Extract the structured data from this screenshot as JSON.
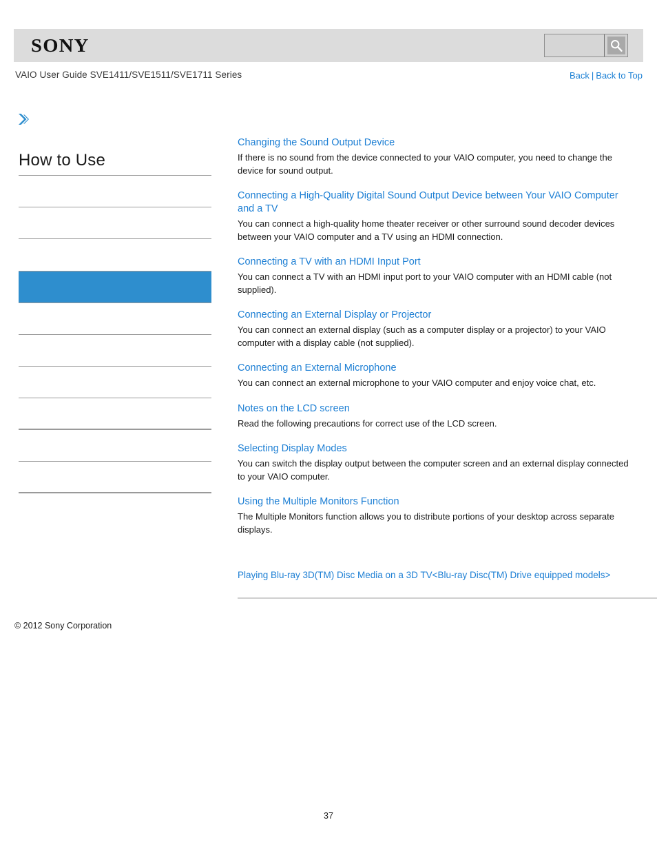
{
  "header": {
    "brand": "SONY",
    "search": {
      "value": "",
      "placeholder": ""
    },
    "search_icon": "search-icon"
  },
  "guide": {
    "title": "VAIO User Guide SVE1411/SVE1511/SVE1711 Series",
    "nav": {
      "back": "Back",
      "separator": "|",
      "back_to_top": "Back to Top"
    }
  },
  "sidebar": {
    "chevron_icon": "chevron-right-icon",
    "heading": "How to Use",
    "items": [
      {
        "label": "",
        "active": false
      },
      {
        "label": "",
        "active": false
      },
      {
        "label": "",
        "active": false
      },
      {
        "label": "",
        "active": true
      },
      {
        "label": "",
        "active": false
      },
      {
        "label": "",
        "active": false
      },
      {
        "label": "",
        "active": false
      },
      {
        "label": "",
        "active": false
      },
      {
        "label": "",
        "active": false
      },
      {
        "label": "",
        "active": false
      }
    ]
  },
  "main": {
    "entries": [
      {
        "title": "Changing the Sound Output Device",
        "desc": "If there is no sound from the device connected to your VAIO computer, you need to change the device for sound output."
      },
      {
        "title": "Connecting a High-Quality Digital Sound Output Device between Your VAIO Computer and a TV",
        "desc": "You can connect a high-quality home theater receiver or other surround sound decoder devices between your VAIO computer and a TV using an HDMI connection."
      },
      {
        "title": "Connecting a TV with an HDMI Input Port",
        "desc": "You can connect a TV with an HDMI input port to your VAIO computer with an HDMI cable (not supplied)."
      },
      {
        "title": "Connecting an External Display or Projector",
        "desc": "You can connect an external display (such as a computer display or a projector) to your VAIO computer with a display cable (not supplied)."
      },
      {
        "title": "Connecting an External Microphone",
        "desc": "You can connect an external microphone to your VAIO computer and enjoy voice chat, etc."
      },
      {
        "title": "Notes on the LCD screen",
        "desc": "Read the following precautions for correct use of the LCD screen."
      },
      {
        "title": "Selecting Display Modes",
        "desc": "You can switch the display output between the computer screen and an external display connected to your VAIO computer."
      },
      {
        "title": "Using the Multiple Monitors Function",
        "desc": "The Multiple Monitors function allows you to distribute portions of your desktop across separate displays."
      }
    ],
    "extra_link": "Playing Blu-ray 3D(TM) Disc Media on a 3D TV<Blu-ray Disc(TM) Drive equipped models>"
  },
  "footer": {
    "copyright": "© 2012 Sony Corporation",
    "page_number": "37"
  },
  "colors": {
    "link": "#1d7fd4",
    "accent": "#2e8ece",
    "header_band": "#dcdcdc",
    "divider": "#9a9a9a"
  }
}
